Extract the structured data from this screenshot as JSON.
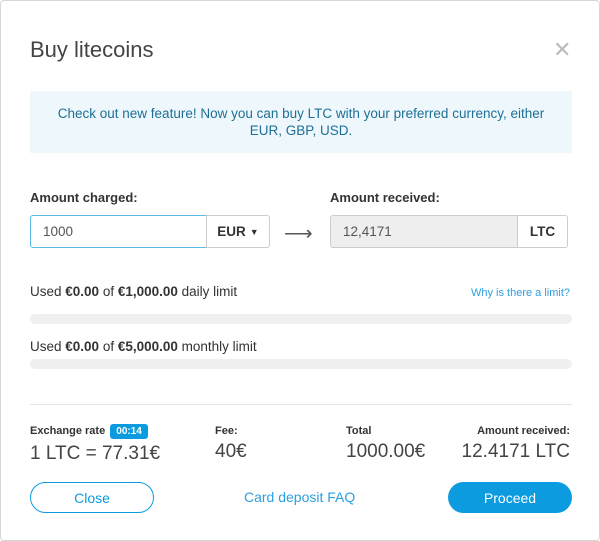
{
  "title": "Buy litecoins",
  "info": "Check out new feature! Now you can buy LTC with your preferred currency, either EUR, GBP, USD.",
  "charged": {
    "label": "Amount charged:",
    "value": "1000",
    "currency": "EUR"
  },
  "received": {
    "label": "Amount received:",
    "value": "12,4171",
    "currency": "LTC"
  },
  "daily": {
    "pre": "Used ",
    "used": "€0.00",
    "mid": " of ",
    "limit": "€1,000.00",
    "post": " daily limit",
    "progress": 0
  },
  "monthly": {
    "pre": "Used ",
    "used": "€0.00",
    "mid": " of ",
    "limit": "€5,000.00",
    "post": " monthly limit",
    "progress": 0
  },
  "why_link": "Why is there a limit?",
  "stats": {
    "rate_label": "Exchange rate",
    "timer": "00:14",
    "rate_value": "1 LTC = 77.31€",
    "fee_label": "Fee:",
    "fee_value": "40€",
    "total_label": "Total",
    "total_value": "1000.00€",
    "recv_label": "Amount received:",
    "recv_value": "12.4171 LTC"
  },
  "buttons": {
    "close": "Close",
    "faq": "Card deposit FAQ",
    "proceed": "Proceed"
  },
  "colors": {
    "accent": "#0d9be0"
  }
}
